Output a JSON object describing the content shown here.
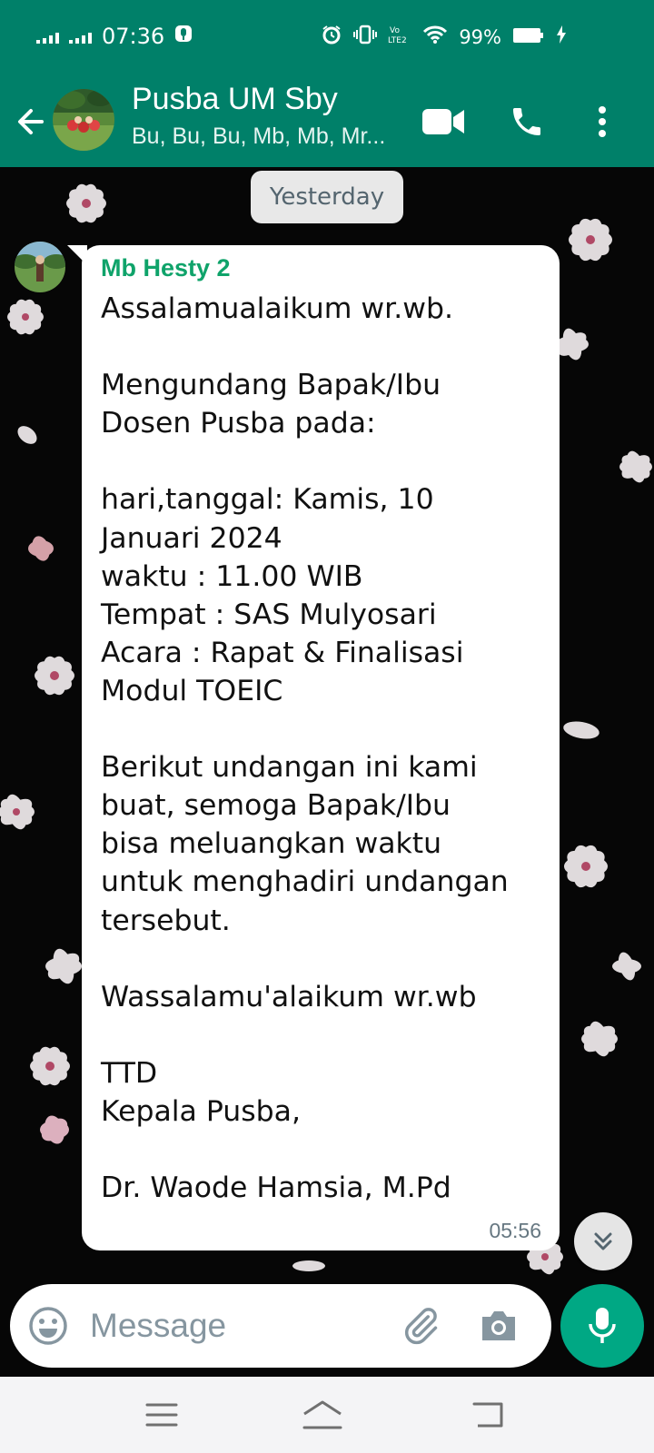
{
  "status_bar": {
    "time": "07:36",
    "battery_text": "99%",
    "network_label": "Vo LTE2"
  },
  "header": {
    "title": "Pusba UM Sby",
    "subtitle": "Bu, Bu, Bu, Mb, Mb, Mr..."
  },
  "chat": {
    "date_chip": "Yesterday",
    "message": {
      "sender": "Mb Hesty 2",
      "text": "Assalamualaikum wr.wb.\n\nMengundang Bapak/Ibu\nDosen Pusba pada:\n\nhari,tanggal: Kamis, 10\nJanuari 2024\nwaktu : 11.00 WIB\nTempat : SAS Mulyosari\nAcara : Rapat & Finalisasi\nModul TOEIC\n\nBerikut undangan ini kami\nbuat, semoga Bapak/Ibu\nbisa meluangkan waktu\nuntuk menghadiri undangan\ntersebut.\n\nWassalamu'alaikum wr.wb\n\nTTD\nKepala Pusba,\n\nDr. Waode Hamsia, M.Pd",
      "time": "05:56"
    }
  },
  "composer": {
    "placeholder": "Message"
  },
  "colors": {
    "brand_green": "#008069",
    "sender_name": "#0fa36a",
    "mic_button": "#00a884"
  },
  "icons": {
    "back": "arrow-left-icon",
    "video_call": "video-camera-icon",
    "voice_call": "phone-icon",
    "menu": "more-vertical-icon",
    "scroll_down": "double-chevron-down-icon",
    "emoji": "emoji-icon",
    "attach": "paperclip-icon",
    "camera": "camera-icon",
    "mic": "microphone-icon"
  }
}
